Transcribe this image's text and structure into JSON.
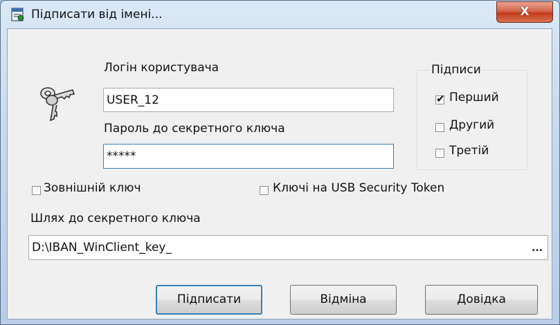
{
  "window": {
    "title": "Підписати від імені...",
    "close_label": "X"
  },
  "login": {
    "label": "Логін користувача",
    "value": "USER_12"
  },
  "password": {
    "label": "Пароль до секретного ключа",
    "value": "*****"
  },
  "signatures": {
    "title": "Підписи",
    "options": [
      {
        "label": "Перший",
        "checked": true
      },
      {
        "label": "Другий",
        "checked": false
      },
      {
        "label": "Третій",
        "checked": false
      }
    ]
  },
  "external_key": {
    "label": "Зовнішній ключ",
    "checked": false
  },
  "usb_token": {
    "label": "Ключі на USB Security Token",
    "checked": false
  },
  "key_path": {
    "label": "Шлях до секретного ключа",
    "value": "D:\\IBAN_WinClient_key_",
    "browse_label": "..."
  },
  "buttons": {
    "sign": "Підписати",
    "cancel": "Відміна",
    "help": "Довідка"
  }
}
